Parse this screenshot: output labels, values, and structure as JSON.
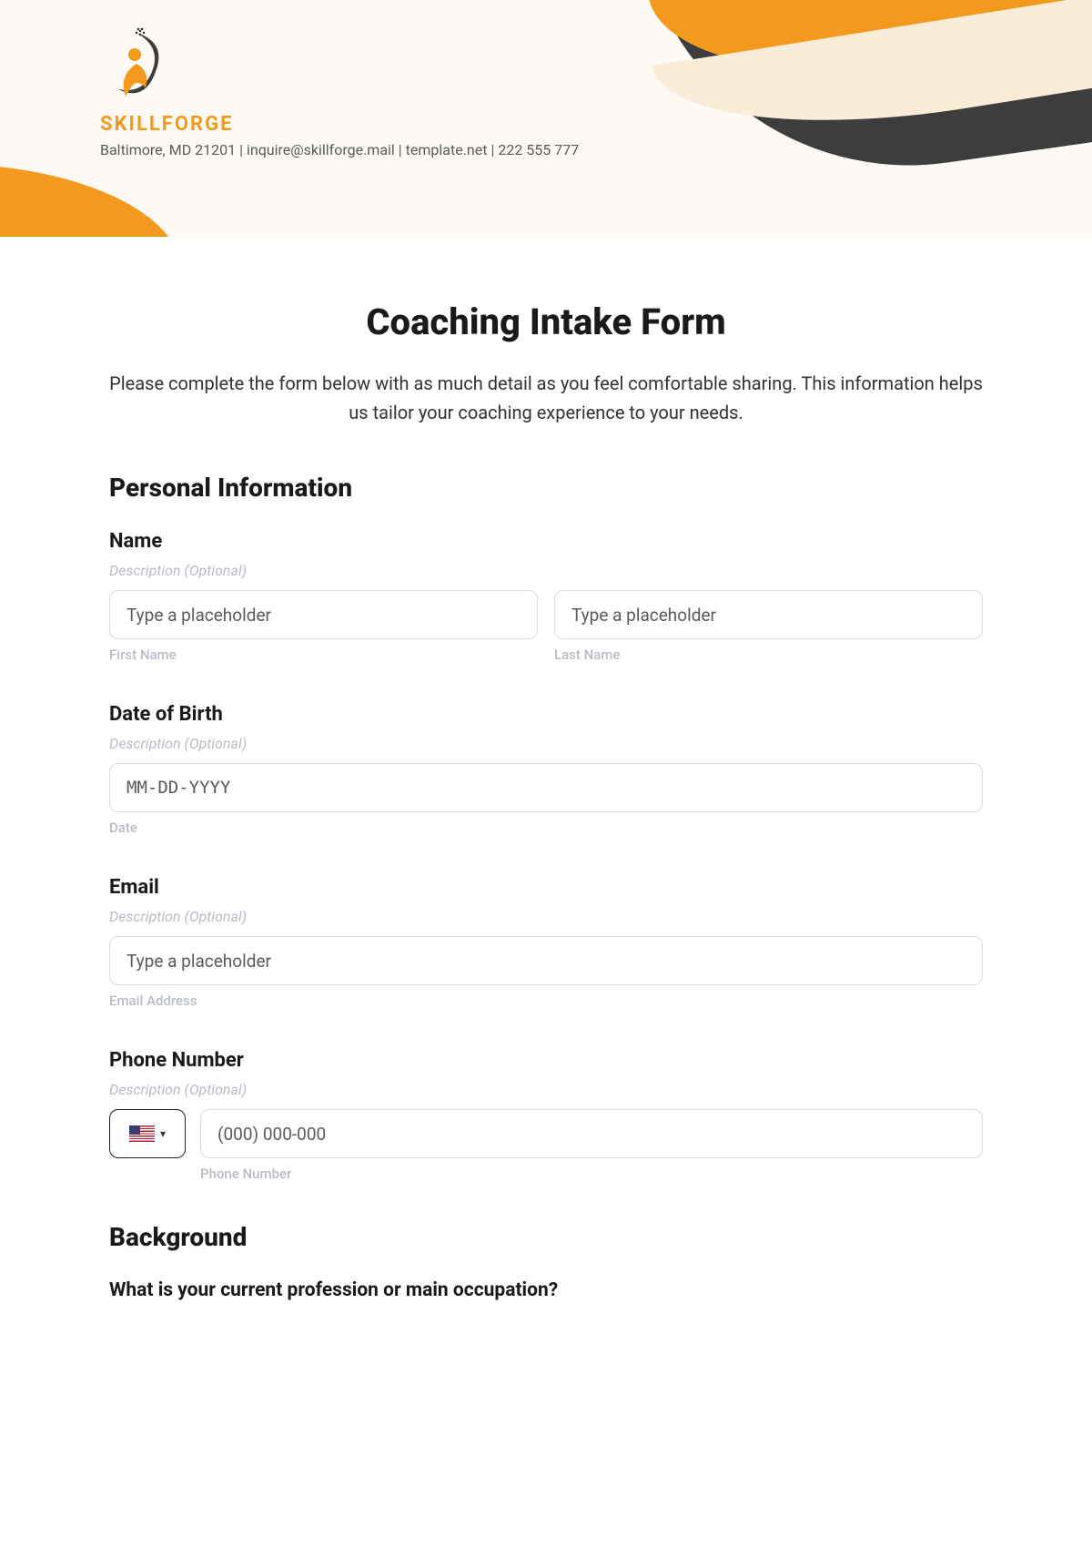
{
  "brand": {
    "name": "SKILLFORGE",
    "contact": "Baltimore, MD 21201 | inquire@skillforge.mail | template.net | 222 555 777"
  },
  "form": {
    "title": "Coaching Intake Form",
    "intro": "Please complete the form below with as much detail as you feel comfortable sharing. This information helps us tailor your coaching experience to your needs."
  },
  "sections": {
    "personal": {
      "title": "Personal Information",
      "name": {
        "label": "Name",
        "desc": "Description (Optional)",
        "first_placeholder": "Type a placeholder",
        "first_sub": "First Name",
        "last_placeholder": "Type a placeholder",
        "last_sub": "Last Name"
      },
      "dob": {
        "label": "Date of Birth",
        "desc": "Description (Optional)",
        "placeholder": "MM-DD-YYYY",
        "sub": "Date"
      },
      "email": {
        "label": "Email",
        "desc": "Description (Optional)",
        "placeholder": "Type a placeholder",
        "sub": "Email Address"
      },
      "phone": {
        "label": "Phone Number",
        "desc": "Description (Optional)",
        "placeholder": "(000) 000-000",
        "sub": "Phone Number"
      }
    },
    "background": {
      "title": "Background",
      "q1": "What is your current profession or main occupation?"
    }
  }
}
